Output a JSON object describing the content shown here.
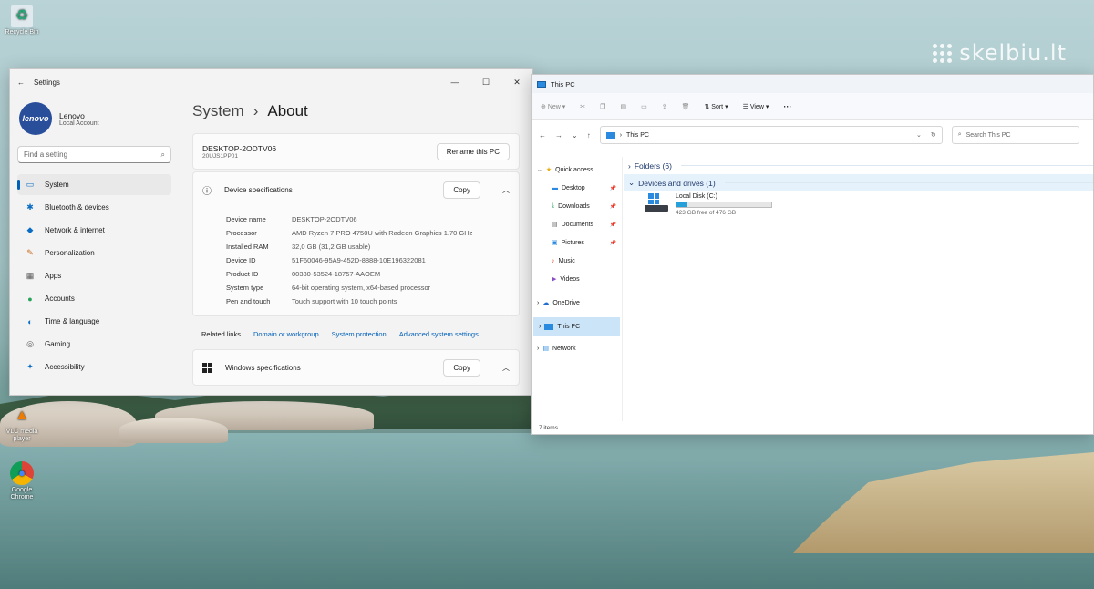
{
  "desktop": {
    "icons": [
      {
        "label": "Recycle Bin",
        "glyph": "♻"
      },
      {
        "label": "VLC media player",
        "glyph": "▲"
      },
      {
        "label": "Google Chrome",
        "glyph": "●"
      }
    ],
    "watermark": "skelbiu.lt"
  },
  "settings": {
    "window_title": "Settings",
    "profile": {
      "logo_text": "lenovo",
      "name": "Lenovo",
      "account": "Local Account"
    },
    "search_placeholder": "Find a setting",
    "nav": [
      {
        "label": "System",
        "icon": "monitor-icon",
        "glyph": "▭"
      },
      {
        "label": "Bluetooth & devices",
        "icon": "bluetooth-icon",
        "glyph": "✱"
      },
      {
        "label": "Network & internet",
        "icon": "wifi-icon",
        "glyph": "◆"
      },
      {
        "label": "Personalization",
        "icon": "brush-icon",
        "glyph": "✎"
      },
      {
        "label": "Apps",
        "icon": "apps-icon",
        "glyph": "▦"
      },
      {
        "label": "Accounts",
        "icon": "person-icon",
        "glyph": "●"
      },
      {
        "label": "Time & language",
        "icon": "globe-icon",
        "glyph": "◐"
      },
      {
        "label": "Gaming",
        "icon": "gamepad-icon",
        "glyph": "◎"
      },
      {
        "label": "Accessibility",
        "icon": "accessibility-icon",
        "glyph": "✦"
      }
    ],
    "breadcrumb": {
      "parent": "System",
      "separator": "›",
      "current": "About"
    },
    "pc": {
      "name": "DESKTOP-2ODTV06",
      "model": "20UJS1PP01",
      "rename_label": "Rename this PC"
    },
    "device_specs": {
      "title": "Device specifications",
      "copy_label": "Copy",
      "rows": [
        {
          "key": "Device name",
          "value": "DESKTOP-2ODTV06"
        },
        {
          "key": "Processor",
          "value": "AMD Ryzen 7 PRO 4750U with Radeon Graphics    1.70 GHz"
        },
        {
          "key": "Installed RAM",
          "value": "32,0 GB (31,2 GB usable)"
        },
        {
          "key": "Device ID",
          "value": "51F60046-95A9-452D-8888-10E196322081"
        },
        {
          "key": "Product ID",
          "value": "00330-53524-18757-AAOEM"
        },
        {
          "key": "System type",
          "value": "64-bit operating system, x64-based processor"
        },
        {
          "key": "Pen and touch",
          "value": "Touch support with 10 touch points"
        }
      ]
    },
    "related": {
      "label": "Related links",
      "links": [
        "Domain or workgroup",
        "System protection",
        "Advanced system settings"
      ]
    },
    "windows_specs": {
      "title": "Windows specifications",
      "copy_label": "Copy"
    }
  },
  "explorer": {
    "window_title": "This PC",
    "toolbar": {
      "new_label": "New",
      "sort_label": "Sort",
      "view_label": "View",
      "more_label": "···"
    },
    "address": "This PC",
    "search_placeholder": "Search This PC",
    "nav": {
      "quick_access": "Quick access",
      "pinned": [
        "Desktop",
        "Downloads",
        "Documents",
        "Pictures"
      ],
      "unpinned": [
        "Music",
        "Videos"
      ],
      "onedrive": "OneDrive",
      "this_pc": "This PC",
      "network": "Network"
    },
    "groups": {
      "folders": "Folders (6)",
      "devices": "Devices and drives (1)"
    },
    "drive": {
      "name": "Local Disk (C:)",
      "free_text": "423 GB free of 476 GB",
      "used_fraction": 0.111
    },
    "status": "7 items"
  }
}
